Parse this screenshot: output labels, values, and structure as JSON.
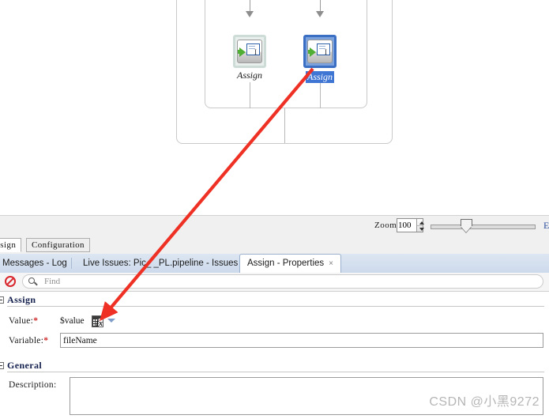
{
  "canvas": {
    "nodes": [
      {
        "label": "Assign",
        "selected": false
      },
      {
        "label": "Assign",
        "selected": true
      }
    ]
  },
  "zoom_bar": {
    "label": "Zoom:",
    "value": "100",
    "slider_percent": 29,
    "right_glyph": "E"
  },
  "design_tabs": [
    {
      "label": "esign",
      "active": true
    },
    {
      "label": "Configuration",
      "active": false
    }
  ],
  "lower_tabs": [
    {
      "label": "Messages - Log",
      "active": false
    },
    {
      "label": "Live Issues: Pic_  _PL.pipeline - Issues",
      "active": false
    },
    {
      "label": "Assign - Properties",
      "active": true,
      "close": "×"
    }
  ],
  "find": {
    "placeholder": "Find",
    "value": "",
    "block_icon": "no-entry-icon",
    "search_icon": "search-icon"
  },
  "sections": [
    {
      "title": "Assign",
      "fields": [
        {
          "label": "Value:",
          "required": "*",
          "value": "$value",
          "kind": "expression",
          "fx_icon": "function-fx-icon",
          "dropdown_icon": "chevron-down-icon"
        },
        {
          "label": "Variable:",
          "required": "*",
          "value": "fileName",
          "kind": "text"
        }
      ]
    },
    {
      "title": "General",
      "fields": [
        {
          "label": "Description:",
          "required": "",
          "value": "",
          "kind": "textarea"
        }
      ]
    }
  ],
  "watermark": "CSDN @小黑9272",
  "colors": {
    "selection_blue": "#3f76d4",
    "node_select_border": "#3a6fc4",
    "required_red": "#cf2b2b",
    "annotation_red": "#ee3124",
    "tabbar_blue": "#cddaec",
    "section_title": "#14204e"
  }
}
